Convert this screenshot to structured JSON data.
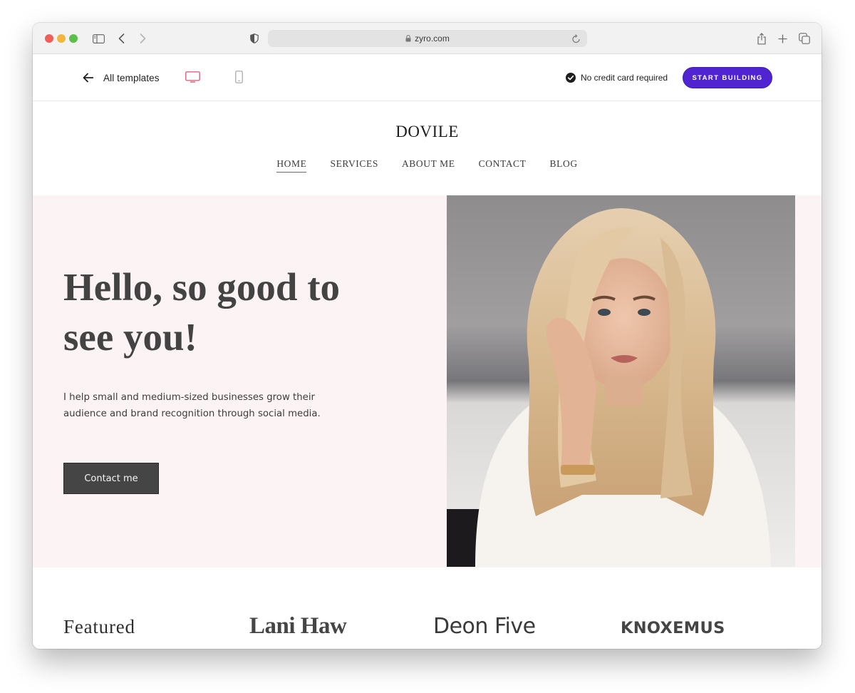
{
  "browser": {
    "url": "zyro.com",
    "icons": [
      "sidebar-icon",
      "back-icon",
      "forward-icon",
      "privacy-shield-icon",
      "lock-icon",
      "reload-icon",
      "share-icon",
      "new-tab-icon",
      "tab-overview-icon"
    ]
  },
  "preview_bar": {
    "back_label": "All templates",
    "device_options": [
      "desktop",
      "mobile"
    ],
    "selected_device": "desktop",
    "no_credit_card": "No credit card required",
    "cta_label": "START BUILDING",
    "accent_color": "#5025d1",
    "selected_device_color": "#e0607e"
  },
  "site": {
    "logo": "DOVILE",
    "nav": [
      {
        "label": "HOME",
        "active": true
      },
      {
        "label": "SERVICES",
        "active": false
      },
      {
        "label": "ABOUT ME",
        "active": false
      },
      {
        "label": "CONTACT",
        "active": false
      },
      {
        "label": "BLOG",
        "active": false
      }
    ],
    "hero": {
      "title_line1": "Hello, so good to",
      "title_line2": "see you!",
      "text": "I help small and medium-sized businesses grow their audience and brand recognition through social media.",
      "button_label": "Contact me",
      "background_color": "#fcf4f4",
      "photo_alt": "Portrait of a smiling blonde woman in a white sweater resting her head on her hand"
    },
    "featured": {
      "label": "Featured",
      "logos": [
        "Lani Haw",
        "Deon Five",
        "KNOXEMUS"
      ]
    }
  }
}
